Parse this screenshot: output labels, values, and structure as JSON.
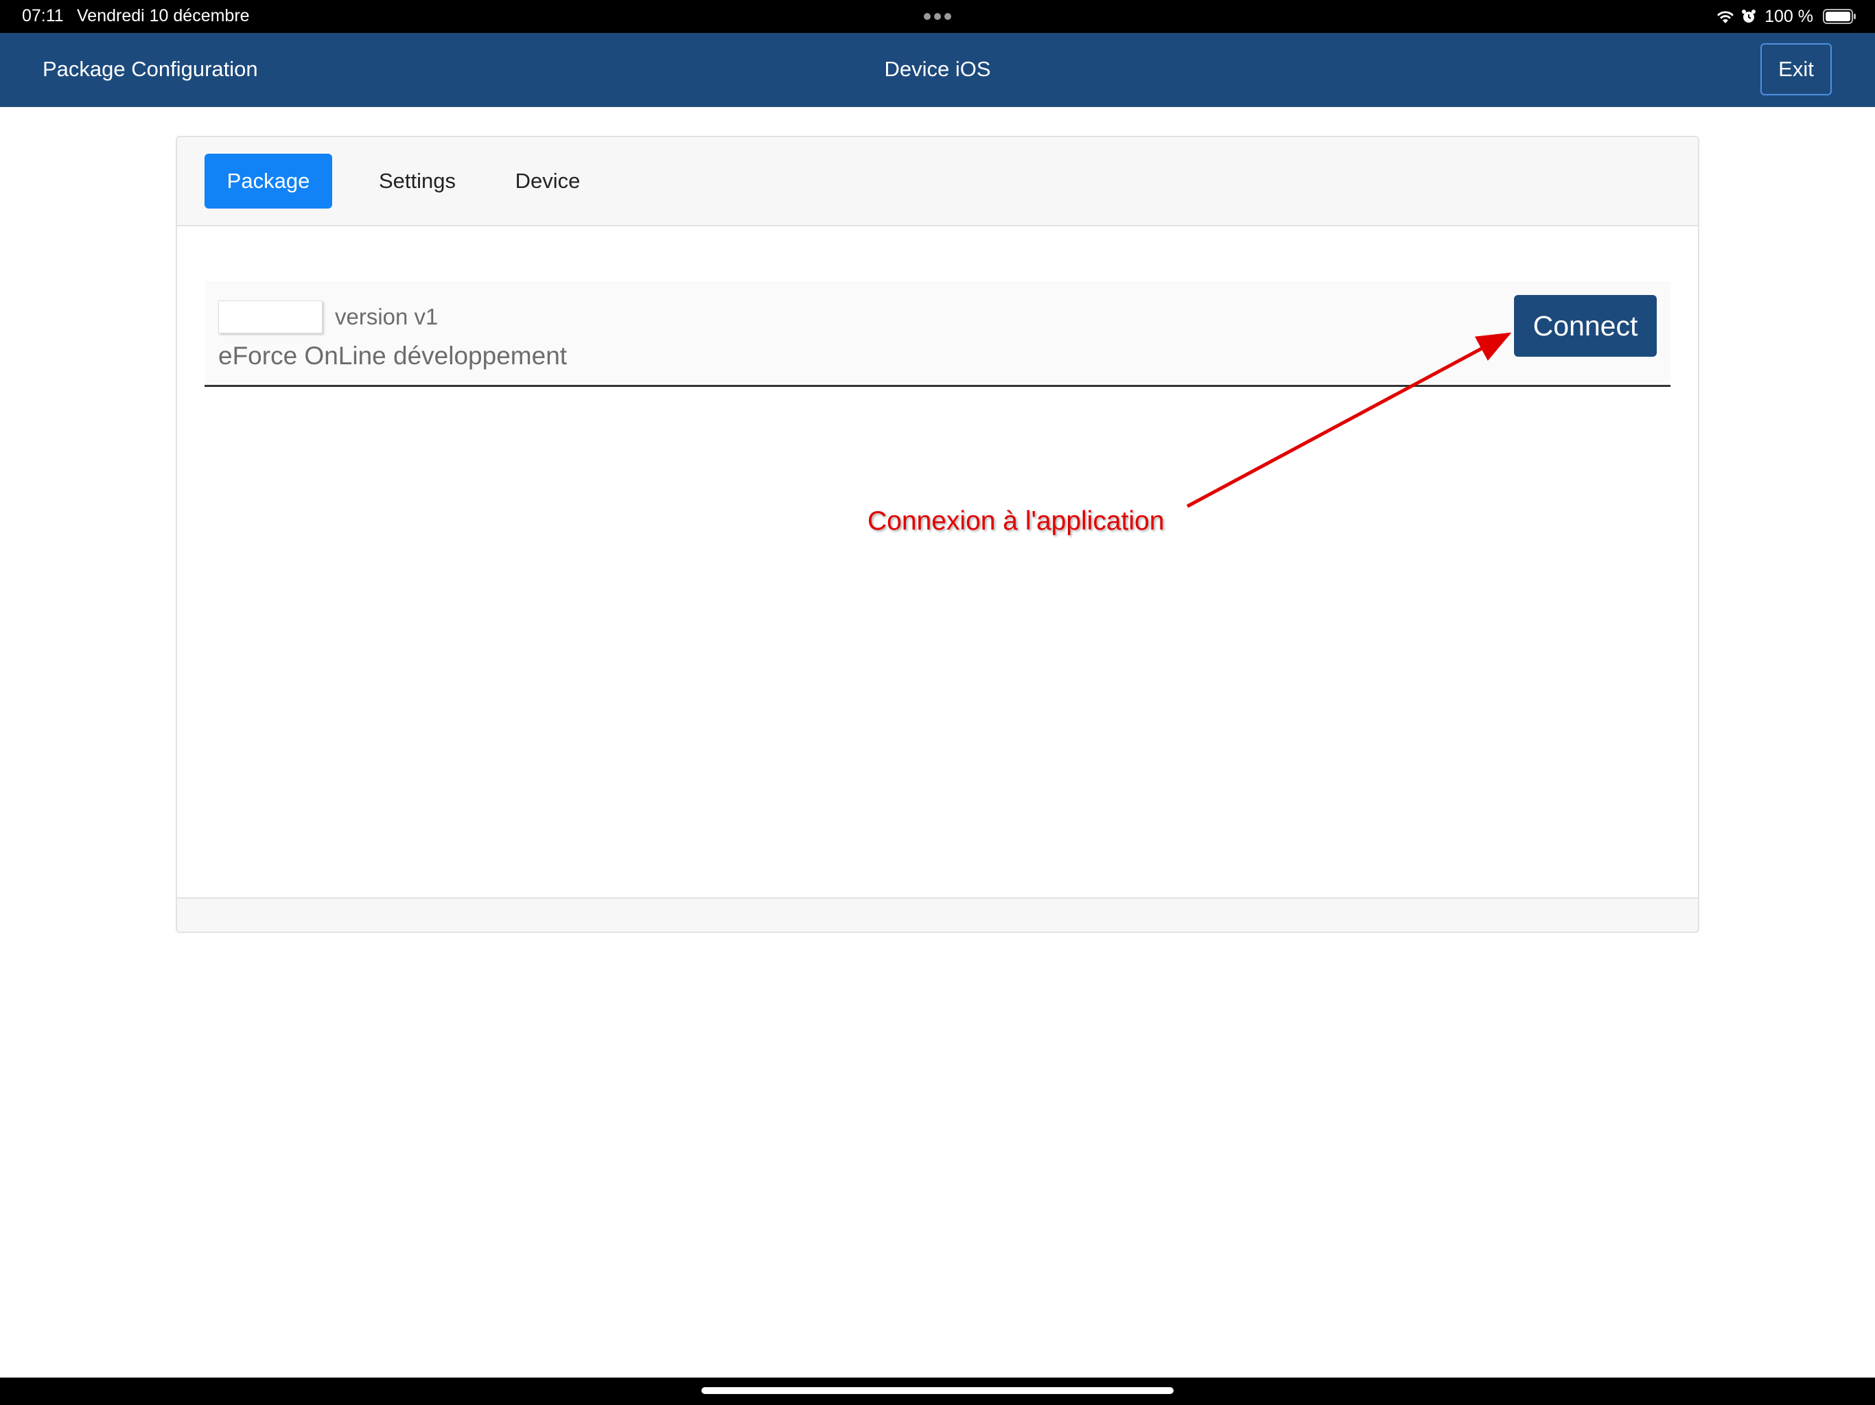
{
  "status_bar": {
    "time": "07:11",
    "date": "Vendredi 10 décembre",
    "battery": "100 %",
    "icons": [
      "wifi-icon",
      "alarm-icon",
      "battery-icon"
    ]
  },
  "header": {
    "title": "Package Configuration",
    "device": "Device iOS",
    "exit_label": "Exit"
  },
  "tabs": [
    {
      "label": "Package",
      "active": true
    },
    {
      "label": "Settings",
      "active": false
    },
    {
      "label": "Device",
      "active": false
    }
  ],
  "package": {
    "version": "version v1",
    "name": "eForce OnLine développement",
    "connect_label": "Connect"
  },
  "annotation": {
    "text": "Connexion à l'application",
    "color": "#e10000"
  },
  "colors": {
    "header": "#1d4a7c",
    "active_tab": "#1283f6",
    "connect_button": "#1d4a7c"
  }
}
